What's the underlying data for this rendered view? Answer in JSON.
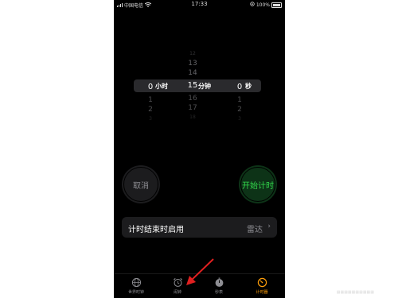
{
  "status_bar": {
    "carrier": "中国电信",
    "time": "17:33",
    "battery": "100%"
  },
  "picker": {
    "hours": {
      "above2": "",
      "above1": "",
      "selected": "0",
      "below1": "1",
      "below2": "2",
      "below3": "3",
      "unit": "小时"
    },
    "minutes": {
      "above2": "12",
      "above1": "13",
      "above0": "14",
      "selected": "15",
      "below1": "16",
      "below2": "17",
      "below3": "18",
      "unit": "分钟"
    },
    "seconds": {
      "selected": "0",
      "below1": "1",
      "below2": "2",
      "below3": "3",
      "unit": "秒"
    }
  },
  "buttons": {
    "cancel": "取消",
    "start": "开始计时"
  },
  "sound_row": {
    "label": "计时结束时启用",
    "value": "雷达"
  },
  "tabs": [
    {
      "label": "世界时钟",
      "icon": "globe-icon"
    },
    {
      "label": "闹钟",
      "icon": "alarm-clock-icon"
    },
    {
      "label": "秒表",
      "icon": "stopwatch-icon"
    },
    {
      "label": "计时器",
      "icon": "timer-icon"
    }
  ],
  "colors": {
    "start_green": "#32d74b",
    "active_tab": "#ff9f0a",
    "annotation_arrow": "#e02020"
  }
}
